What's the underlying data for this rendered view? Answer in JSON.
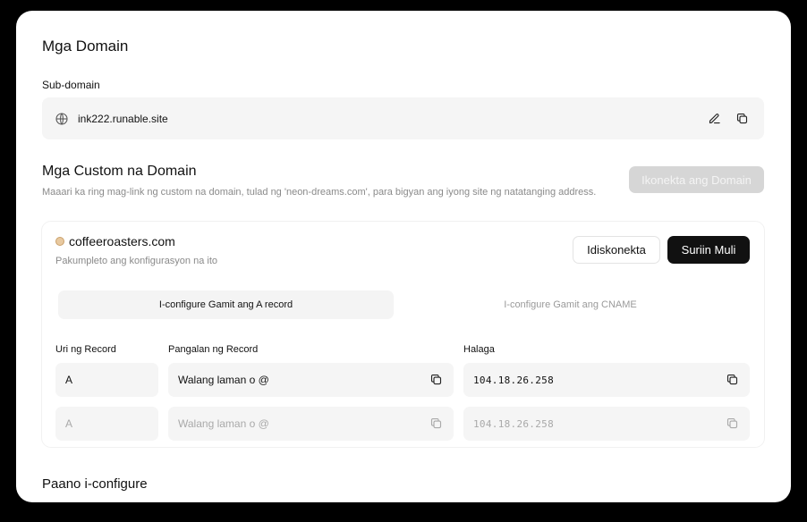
{
  "page": {
    "title": "Mga Domain"
  },
  "subdomain": {
    "label": "Sub-domain",
    "url": "ink222.runable.site"
  },
  "custom": {
    "title": "Mga Custom na Domain",
    "description": "Maaari ka ring mag-link ng custom na domain, tulad ng 'neon-dreams.com', para bigyan ang iyong site ng natatanging address.",
    "connect_label": "Ikonekta ang Domain"
  },
  "domain": {
    "name": "coffeeroasters.com",
    "status": "Pakumpleto ang konfigurasyon na ito",
    "disconnect_label": "Idiskonekta",
    "recheck_label": "Suriin Muli",
    "tabs": [
      {
        "label": "I-configure Gamit ang A record",
        "active": true
      },
      {
        "label": "I-configure Gamit ang CNAME",
        "active": false
      }
    ],
    "columns": {
      "type": "Uri ng Record",
      "name": "Pangalan ng Record",
      "value": "Halaga"
    },
    "records": [
      {
        "type": "A",
        "name": "Walang laman o @",
        "value": "104.18.26.258"
      },
      {
        "type": "A",
        "name": "Walang laman o @",
        "value": "104.18.26.258"
      }
    ]
  },
  "howto": {
    "title": "Paano i-configure"
  },
  "icons": {
    "globe": "globe-icon",
    "edit": "pencil-icon",
    "copy": "copy-icon"
  },
  "colors": {
    "primary_button": "#111111",
    "disabled_button": "#d6d6d6",
    "field_bg": "#f5f5f5",
    "status_dot": "#e8c9a0"
  }
}
